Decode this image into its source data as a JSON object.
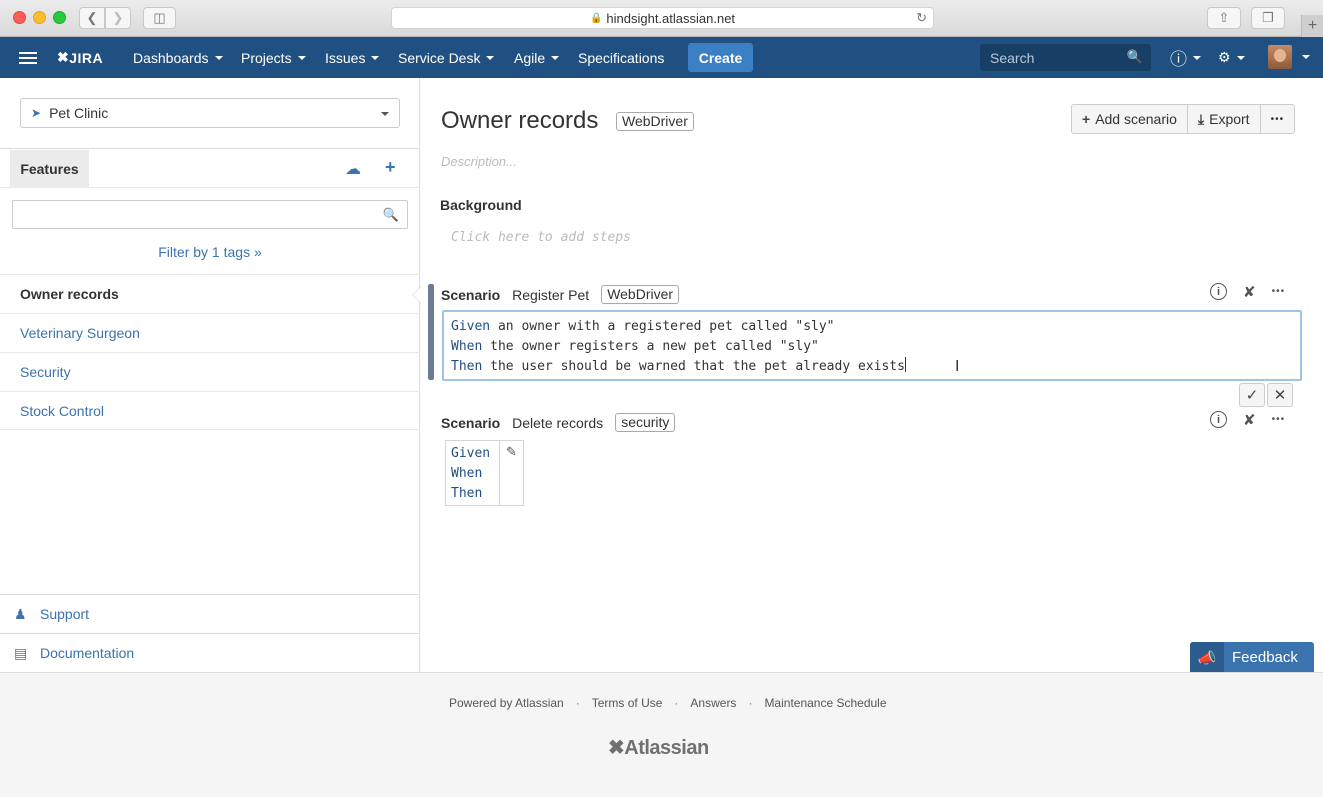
{
  "browser": {
    "url": "hindsight.atlassian.net"
  },
  "header": {
    "logo": "JIRA",
    "nav": [
      "Dashboards",
      "Projects",
      "Issues",
      "Service Desk",
      "Agile"
    ],
    "specifications": "Specifications",
    "create": "Create",
    "search_placeholder": "Search",
    "brand_color": "#205081"
  },
  "sidebar": {
    "project": "Pet Clinic",
    "features_tab": "Features",
    "filter": "Filter by 1 tags »",
    "features": [
      "Owner records",
      "Veterinary Surgeon",
      "Security",
      "Stock Control"
    ],
    "active_feature": "Owner records",
    "support": "Support",
    "documentation": "Documentation"
  },
  "main": {
    "title": "Owner records",
    "title_tag": "WebDriver",
    "add_scenario": "Add scenario",
    "export": "Export",
    "more": "•••",
    "description_placeholder": "Description...",
    "background_title": "Background",
    "background_placeholder": "Click here to add steps",
    "scenarios": [
      {
        "keyword": "Scenario",
        "name": "Register Pet",
        "tag": "WebDriver",
        "steps": [
          {
            "kw": "Given",
            "text": " an owner with a registered pet called \"sly\""
          },
          {
            "kw": "When",
            "text": " the owner registers a new pet called \"sly\""
          },
          {
            "kw": "Then",
            "text": " the user should be warned that the pet already exists"
          }
        ]
      },
      {
        "keyword": "Scenario",
        "name": "Delete records",
        "tag": "security",
        "steps": [
          {
            "kw": "Given"
          },
          {
            "kw": "When"
          },
          {
            "kw": "Then"
          }
        ]
      }
    ]
  },
  "feedback": "Feedback",
  "footer": {
    "links": [
      "Powered by Atlassian",
      "Terms of Use",
      "Answers",
      "Maintenance Schedule"
    ],
    "logo": "Atlassian"
  }
}
